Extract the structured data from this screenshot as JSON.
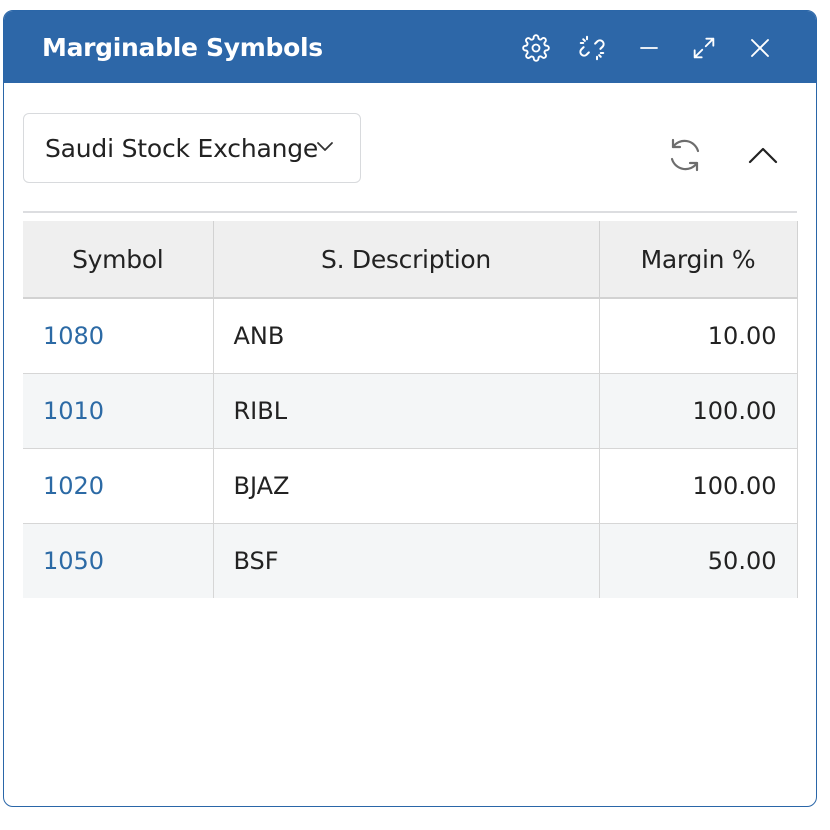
{
  "window": {
    "title": "Marginable Symbols",
    "controls": [
      {
        "name": "settings-icon"
      },
      {
        "name": "unlink-icon"
      },
      {
        "name": "minimize-icon"
      },
      {
        "name": "maximize-icon"
      },
      {
        "name": "close-icon"
      }
    ]
  },
  "toolbar": {
    "exchange": "Saudi Stock Exchange",
    "refresh_icon": "refresh-icon",
    "collapse_icon": "chevron-up-icon"
  },
  "table": {
    "columns": [
      "Symbol",
      "S. Description",
      "Margin %"
    ],
    "rows": [
      {
        "symbol": "1080",
        "description": "ANB",
        "margin": "10.00"
      },
      {
        "symbol": "1010",
        "description": "RIBL",
        "margin": "100.00"
      },
      {
        "symbol": "1020",
        "description": "BJAZ",
        "margin": "100.00"
      },
      {
        "symbol": "1050",
        "description": "BSF",
        "margin": "50.00"
      }
    ]
  },
  "colors": {
    "titlebar": "#2d67a8",
    "link": "#2c6aa5",
    "header_bg": "#efefef",
    "alt_row_bg": "#f4f6f7"
  }
}
